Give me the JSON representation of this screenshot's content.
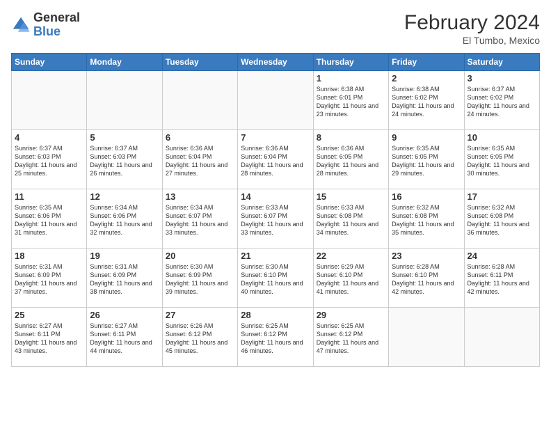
{
  "logo": {
    "general": "General",
    "blue": "Blue"
  },
  "title": "February 2024",
  "location": "El Tumbo, Mexico",
  "days_header": [
    "Sunday",
    "Monday",
    "Tuesday",
    "Wednesday",
    "Thursday",
    "Friday",
    "Saturday"
  ],
  "weeks": [
    [
      {
        "day": "",
        "info": ""
      },
      {
        "day": "",
        "info": ""
      },
      {
        "day": "",
        "info": ""
      },
      {
        "day": "",
        "info": ""
      },
      {
        "day": "1",
        "info": "Sunrise: 6:38 AM\nSunset: 6:01 PM\nDaylight: 11 hours and 23 minutes."
      },
      {
        "day": "2",
        "info": "Sunrise: 6:38 AM\nSunset: 6:02 PM\nDaylight: 11 hours and 24 minutes."
      },
      {
        "day": "3",
        "info": "Sunrise: 6:37 AM\nSunset: 6:02 PM\nDaylight: 11 hours and 24 minutes."
      }
    ],
    [
      {
        "day": "4",
        "info": "Sunrise: 6:37 AM\nSunset: 6:03 PM\nDaylight: 11 hours and 25 minutes."
      },
      {
        "day": "5",
        "info": "Sunrise: 6:37 AM\nSunset: 6:03 PM\nDaylight: 11 hours and 26 minutes."
      },
      {
        "day": "6",
        "info": "Sunrise: 6:36 AM\nSunset: 6:04 PM\nDaylight: 11 hours and 27 minutes."
      },
      {
        "day": "7",
        "info": "Sunrise: 6:36 AM\nSunset: 6:04 PM\nDaylight: 11 hours and 28 minutes."
      },
      {
        "day": "8",
        "info": "Sunrise: 6:36 AM\nSunset: 6:05 PM\nDaylight: 11 hours and 28 minutes."
      },
      {
        "day": "9",
        "info": "Sunrise: 6:35 AM\nSunset: 6:05 PM\nDaylight: 11 hours and 29 minutes."
      },
      {
        "day": "10",
        "info": "Sunrise: 6:35 AM\nSunset: 6:05 PM\nDaylight: 11 hours and 30 minutes."
      }
    ],
    [
      {
        "day": "11",
        "info": "Sunrise: 6:35 AM\nSunset: 6:06 PM\nDaylight: 11 hours and 31 minutes."
      },
      {
        "day": "12",
        "info": "Sunrise: 6:34 AM\nSunset: 6:06 PM\nDaylight: 11 hours and 32 minutes."
      },
      {
        "day": "13",
        "info": "Sunrise: 6:34 AM\nSunset: 6:07 PM\nDaylight: 11 hours and 33 minutes."
      },
      {
        "day": "14",
        "info": "Sunrise: 6:33 AM\nSunset: 6:07 PM\nDaylight: 11 hours and 33 minutes."
      },
      {
        "day": "15",
        "info": "Sunrise: 6:33 AM\nSunset: 6:08 PM\nDaylight: 11 hours and 34 minutes."
      },
      {
        "day": "16",
        "info": "Sunrise: 6:32 AM\nSunset: 6:08 PM\nDaylight: 11 hours and 35 minutes."
      },
      {
        "day": "17",
        "info": "Sunrise: 6:32 AM\nSunset: 6:08 PM\nDaylight: 11 hours and 36 minutes."
      }
    ],
    [
      {
        "day": "18",
        "info": "Sunrise: 6:31 AM\nSunset: 6:09 PM\nDaylight: 11 hours and 37 minutes."
      },
      {
        "day": "19",
        "info": "Sunrise: 6:31 AM\nSunset: 6:09 PM\nDaylight: 11 hours and 38 minutes."
      },
      {
        "day": "20",
        "info": "Sunrise: 6:30 AM\nSunset: 6:09 PM\nDaylight: 11 hours and 39 minutes."
      },
      {
        "day": "21",
        "info": "Sunrise: 6:30 AM\nSunset: 6:10 PM\nDaylight: 11 hours and 40 minutes."
      },
      {
        "day": "22",
        "info": "Sunrise: 6:29 AM\nSunset: 6:10 PM\nDaylight: 11 hours and 41 minutes."
      },
      {
        "day": "23",
        "info": "Sunrise: 6:28 AM\nSunset: 6:10 PM\nDaylight: 11 hours and 42 minutes."
      },
      {
        "day": "24",
        "info": "Sunrise: 6:28 AM\nSunset: 6:11 PM\nDaylight: 11 hours and 42 minutes."
      }
    ],
    [
      {
        "day": "25",
        "info": "Sunrise: 6:27 AM\nSunset: 6:11 PM\nDaylight: 11 hours and 43 minutes."
      },
      {
        "day": "26",
        "info": "Sunrise: 6:27 AM\nSunset: 6:11 PM\nDaylight: 11 hours and 44 minutes."
      },
      {
        "day": "27",
        "info": "Sunrise: 6:26 AM\nSunset: 6:12 PM\nDaylight: 11 hours and 45 minutes."
      },
      {
        "day": "28",
        "info": "Sunrise: 6:25 AM\nSunset: 6:12 PM\nDaylight: 11 hours and 46 minutes."
      },
      {
        "day": "29",
        "info": "Sunrise: 6:25 AM\nSunset: 6:12 PM\nDaylight: 11 hours and 47 minutes."
      },
      {
        "day": "",
        "info": ""
      },
      {
        "day": "",
        "info": ""
      }
    ]
  ]
}
